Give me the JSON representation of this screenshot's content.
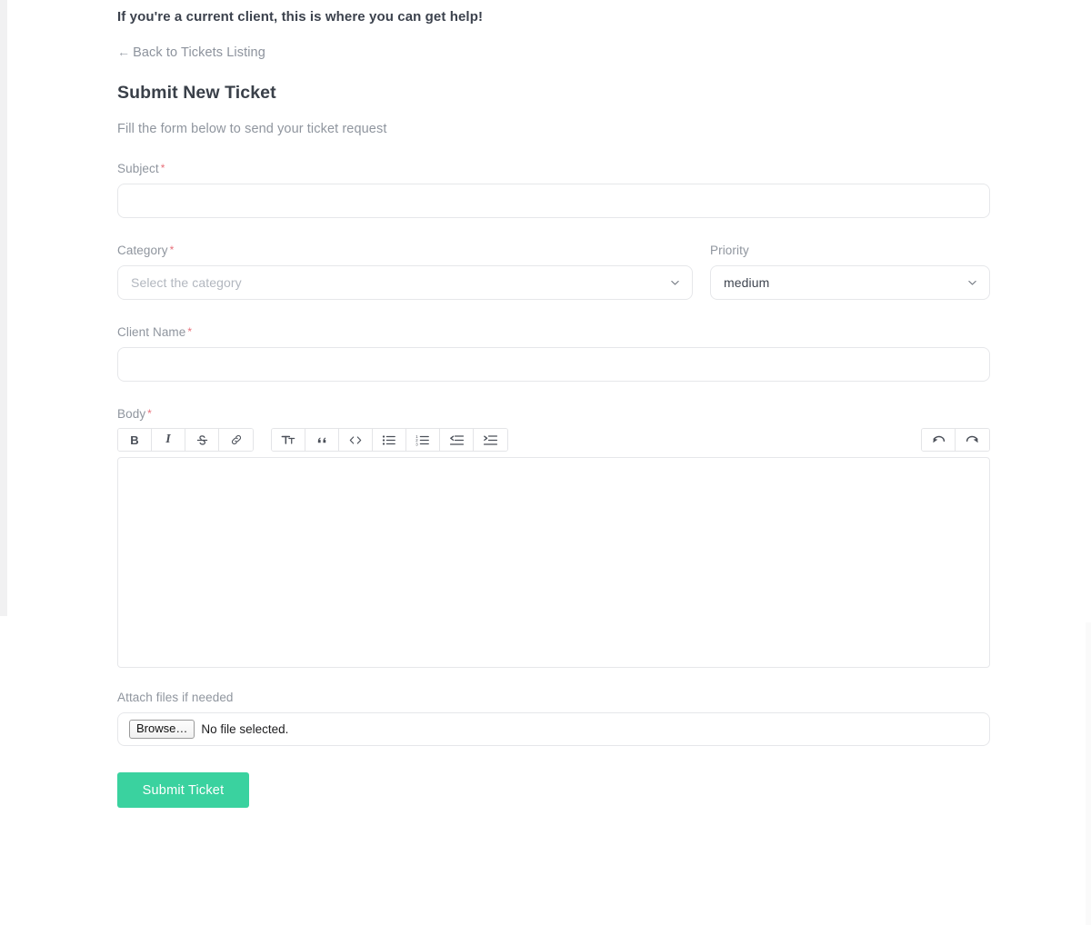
{
  "header": {
    "intro_line": "If you're a current client, this is where you can get help!",
    "back_link": "Back to Tickets Listing",
    "back_arrow": "←",
    "title": "Submit New Ticket",
    "subtitle": "Fill the form below to send your ticket request"
  },
  "form": {
    "subject": {
      "label": "Subject",
      "required_mark": "*",
      "value": "",
      "placeholder": ""
    },
    "category": {
      "label": "Category",
      "required_mark": "*",
      "selected": "Select the category",
      "is_placeholder": true
    },
    "priority": {
      "label": "Priority",
      "selected": "medium",
      "is_placeholder": false
    },
    "client_name": {
      "label": "Client Name",
      "required_mark": "*",
      "value": "",
      "placeholder": ""
    },
    "body": {
      "label": "Body",
      "required_mark": "*",
      "value": "",
      "placeholder": ""
    },
    "attachment": {
      "label": "Attach files if needed",
      "browse_label": "Browse…",
      "status": "No file selected."
    },
    "submit_label": "Submit Ticket"
  },
  "editor_toolbar": {
    "group_format": [
      {
        "name": "bold",
        "glyph": "B"
      },
      {
        "name": "italic",
        "glyph": "I"
      },
      {
        "name": "strikethrough",
        "glyph": "S"
      },
      {
        "name": "link",
        "glyph": "🔗"
      }
    ],
    "group_block": [
      {
        "name": "heading",
        "glyph": "TT"
      },
      {
        "name": "blockquote",
        "glyph": "”"
      },
      {
        "name": "code",
        "glyph": "<>"
      },
      {
        "name": "bullet-list",
        "glyph": "•≡"
      },
      {
        "name": "ordered-list",
        "glyph": "1≡"
      },
      {
        "name": "outdent",
        "glyph": "←≡"
      },
      {
        "name": "indent",
        "glyph": "→≡"
      }
    ],
    "group_history": [
      {
        "name": "undo",
        "glyph": "↶"
      },
      {
        "name": "redo",
        "glyph": "↷"
      }
    ]
  },
  "colors": {
    "accent": "#3ad29f",
    "required_asterisk": "#e8707a",
    "label_text": "#8f959e",
    "heading_text": "#3a4049",
    "border": "#e6e7ea"
  }
}
